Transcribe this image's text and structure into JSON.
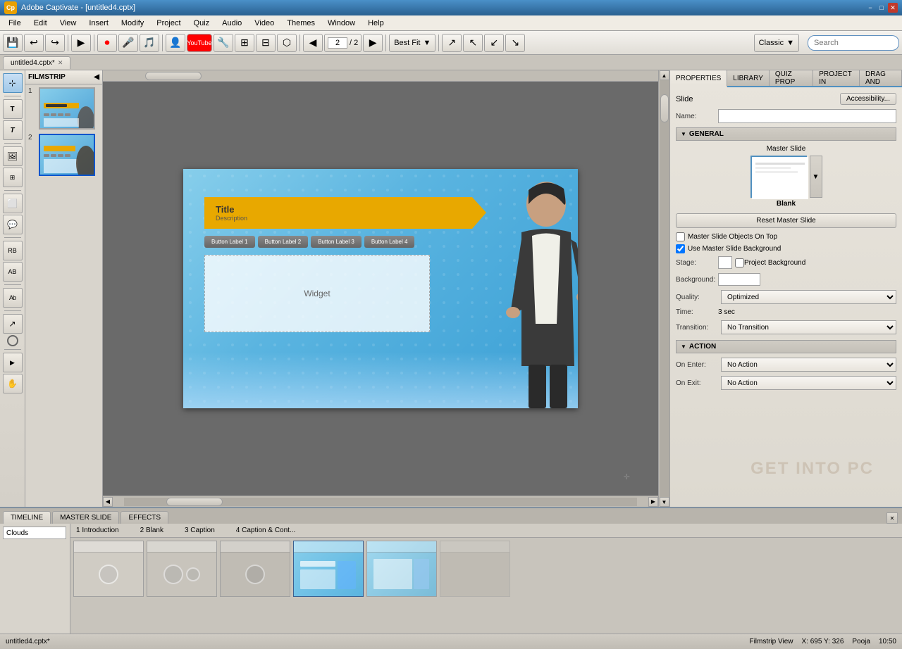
{
  "app": {
    "title": "Adobe Captivate - [untitled4.cptx]",
    "logo": "Cp",
    "tab": "untitled4.cptx*",
    "file_label": "untitled4.cptx*"
  },
  "menu": {
    "items": [
      "File",
      "Edit",
      "View",
      "Insert",
      "Modify",
      "Project",
      "Quiz",
      "Audio",
      "Video",
      "Themes",
      "Window",
      "Help"
    ]
  },
  "toolbar": {
    "nav_current": "2",
    "nav_total": "2",
    "fit_mode": "Best Fit",
    "theme": "Classic"
  },
  "filmstrip": {
    "label": "FILMSTRIP",
    "slides": [
      {
        "num": "1"
      },
      {
        "num": "2"
      }
    ]
  },
  "canvas": {
    "slide_title": "Title",
    "slide_subtitle": "Description",
    "buttons": [
      "Button Label 1",
      "Button Label 2",
      "Button Label 3",
      "Button Label 4"
    ],
    "widget_label": "Widget"
  },
  "properties": {
    "tabs": [
      "PROPERTIES",
      "LIBRARY",
      "QUIZ PROP",
      "PROJECT IN",
      "DRAG AND"
    ],
    "slide_label": "Slide",
    "accessibility_btn": "Accessibility...",
    "name_label": "Name:",
    "general_section": "GENERAL",
    "master_slide_label": "Master Slide",
    "master_slide_name": "Blank",
    "reset_btn": "Reset Master Slide",
    "master_objects_label": "Master Slide Objects On Top",
    "use_bg_label": "Use Master Slide Background",
    "stage_label": "Stage:",
    "bg_label": "Background:",
    "project_bg_label": "Project Background",
    "quality_label": "Quality:",
    "quality_value": "Optimized",
    "time_label": "Time:",
    "time_value": "3 sec",
    "transition_label": "Transition:",
    "transition_value": "No Transition",
    "action_section": "ACTION",
    "on_enter_label": "On Enter:",
    "on_enter_value": "No Action",
    "on_exit_label": "On Exit:",
    "on_exit_value": "No Action"
  },
  "bottom": {
    "tabs": [
      "TIMELINE",
      "MASTER SLIDE",
      "EFFECTS"
    ],
    "search_placeholder": "Clouds",
    "timeline_cols": [
      "1 Introduction",
      "2 Blank",
      "3 Caption",
      "4 Caption & Cont..."
    ]
  },
  "status": {
    "file": "untitled4.cptx*",
    "view": "Filmstrip View",
    "coords": "X: 695 Y: 326",
    "user": "Pooja",
    "time": "10:50"
  }
}
